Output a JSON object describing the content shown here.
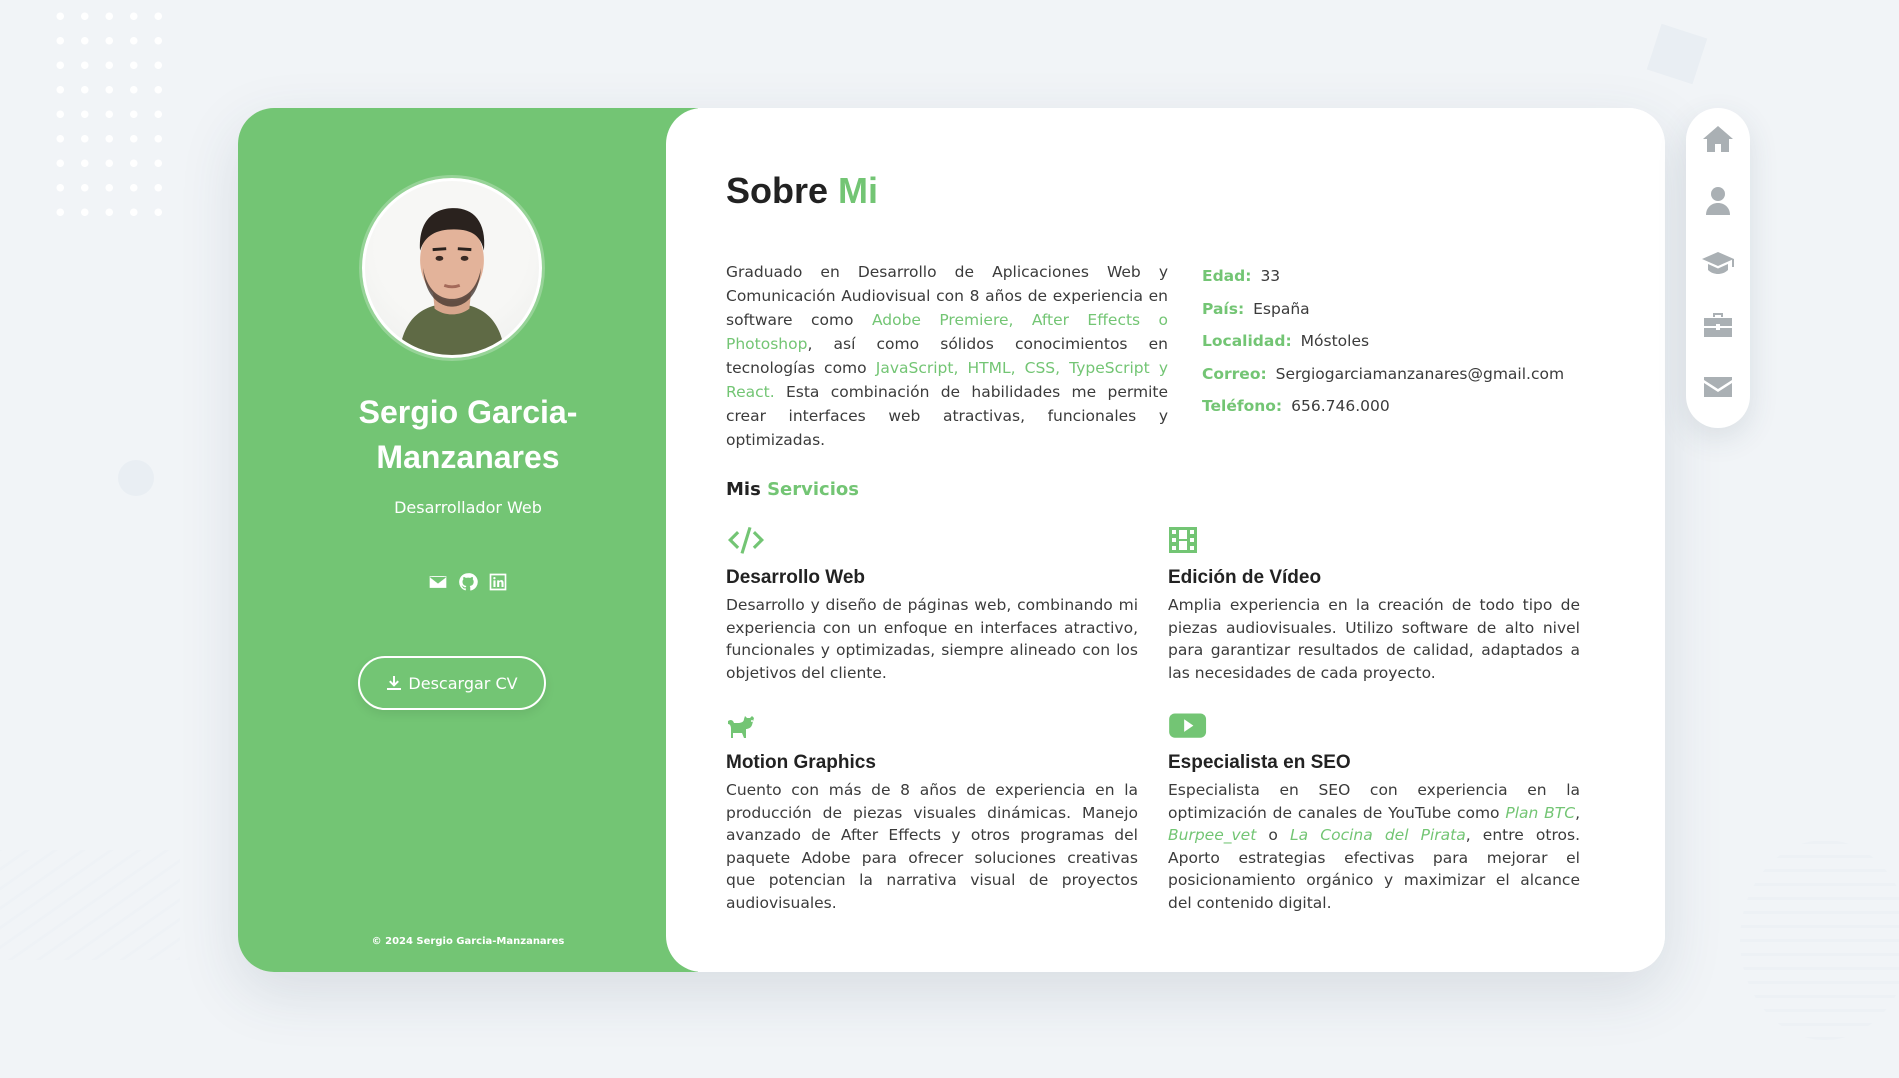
{
  "sidebar": {
    "name": "Sergio Garcia-Manzanares",
    "role": "Desarrollador Web",
    "social_icons": [
      "mail-icon",
      "github-icon",
      "linkedin-icon"
    ],
    "cv_button_label": "Descargar CV",
    "copyright": "© 2024 Sergio Garcia-Manzanares"
  },
  "about": {
    "title_main": "Sobre",
    "title_accent": "Mi",
    "text_1": "Graduado en Desarrollo de Aplicaciones Web y Comunicación Audiovisual con 8 años de experiencia en software como ",
    "highlight_1": "Adobe Premiere, After Effects o Photoshop",
    "text_2": ", así como sólidos conocimientos en tecnologías como ",
    "highlight_2": "JavaScript, HTML, CSS, TypeScript y React.",
    "text_3": " Esta combinación de habilidades me permite crear interfaces web atractivas, funcionales y optimizadas."
  },
  "info": [
    {
      "label": "Edad:",
      "value": "33"
    },
    {
      "label": "País:",
      "value": "España"
    },
    {
      "label": "Localidad:",
      "value": "Móstoles"
    },
    {
      "label": "Correo:",
      "value": "Sergiogarciamanzanares@gmail.com"
    },
    {
      "label": "Teléfono:",
      "value": "656.746.000"
    }
  ],
  "services": {
    "title_main": "Mis",
    "title_accent": "Servicios",
    "items": [
      {
        "icon": "code-icon",
        "title": "Desarrollo Web",
        "text": "Desarrollo y diseño de páginas web, combinando mi experiencia con un enfoque en interfaces atractivo, funcionales y optimizadas, siempre alineado con los objetivos del cliente."
      },
      {
        "icon": "film-icon",
        "title": "Edición de Vídeo",
        "text": "Amplia experiencia en la creación de todo tipo de piezas audiovisuales. Utilizo software de alto nivel para garantizar resultados de calidad, adaptados a las necesidades de cada proyecto."
      },
      {
        "icon": "cat-icon",
        "title": "Motion Graphics",
        "text": "Cuento con más de 8 años de experiencia en la producción de piezas visuales dinámicas. Manejo avanzado de After Effects y otros programas del paquete Adobe para ofrecer soluciones creativas que potencian la narrativa visual de proyectos audiovisuales."
      },
      {
        "icon": "youtube-icon",
        "title": "Especialista en SEO",
        "text_1": "Especialista en SEO con experiencia en la optimización de canales de YouTube como ",
        "link_1": "Plan BTC",
        "sep_1": ", ",
        "link_2": "Burpee_vet",
        "sep_2": " o ",
        "link_3": "La Cocina del Pirata",
        "text_2": ", entre otros. Aporto estrategias efectivas para mejorar el posicionamiento orgánico y maximizar el alcance del contenido digital."
      }
    ]
  },
  "nav": [
    "home-icon",
    "user-icon",
    "graduation-cap-icon",
    "briefcase-icon",
    "envelope-icon"
  ],
  "colors": {
    "accent": "#73c574",
    "background": "#f1f4f7",
    "nav_icon": "#aab0b4"
  }
}
